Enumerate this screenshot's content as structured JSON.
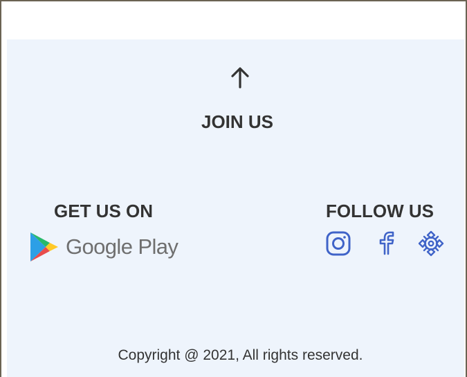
{
  "footer": {
    "back_to_top_icon": "arrow-up-icon",
    "join_label": "JOIN US",
    "app_store": {
      "heading": "GET US ON",
      "store_name": "Google Play",
      "icon": "google-play-icon"
    },
    "social": {
      "heading": "FOLLOW US",
      "icons": [
        "instagram-icon",
        "facebook-icon",
        "support-icon"
      ]
    },
    "copyright": "Copyright @ 2021, All rights reserved."
  },
  "colors": {
    "footer_background": "#eef4fc",
    "text": "#333333",
    "social_icon": "#3f63c8",
    "frame_border": "#6b6353"
  }
}
